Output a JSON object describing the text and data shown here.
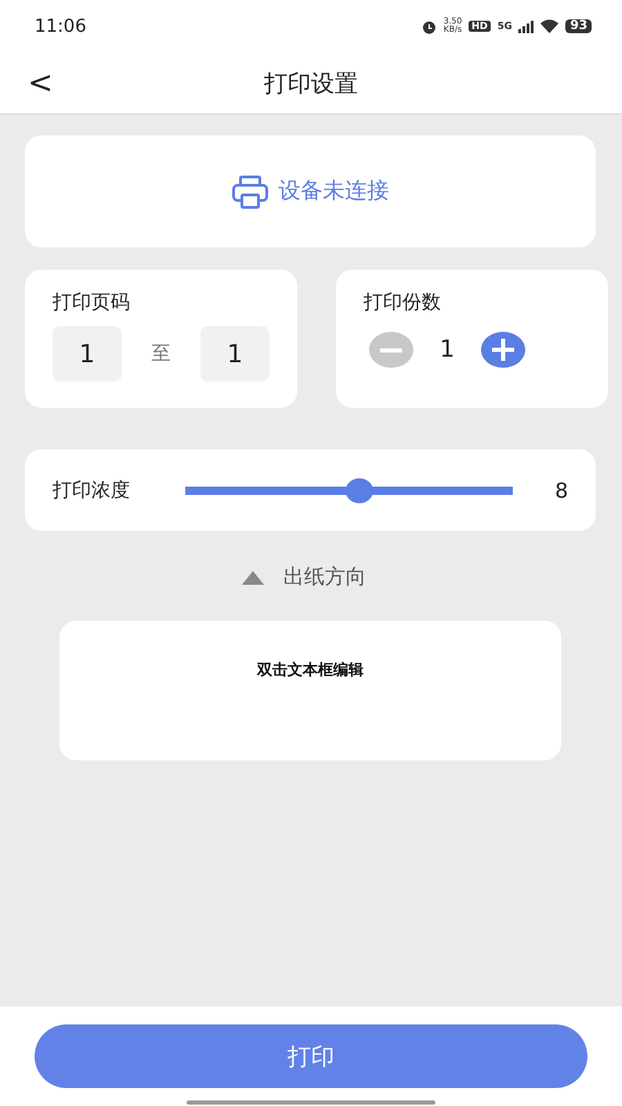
{
  "status_bar": {
    "time": "11:06",
    "speed_value": "3.50",
    "speed_unit": "KB/s",
    "hd": "HD",
    "network": "5G",
    "battery": "93"
  },
  "header": {
    "back": "<",
    "title": "打印设置"
  },
  "device": {
    "label": "设备未连接"
  },
  "page_range": {
    "title": "打印页码",
    "from": "1",
    "separator": "至",
    "to": "1"
  },
  "copies": {
    "title": "打印份数",
    "value": "1",
    "minus_disabled": true,
    "plus_disabled": false
  },
  "density": {
    "label": "打印浓度",
    "level": 0.53,
    "reading": "8"
  },
  "direction": {
    "label": "出纸方向",
    "expanded": true
  },
  "canvas": {
    "text": "双击文本框编辑"
  },
  "print_button": "打印"
}
